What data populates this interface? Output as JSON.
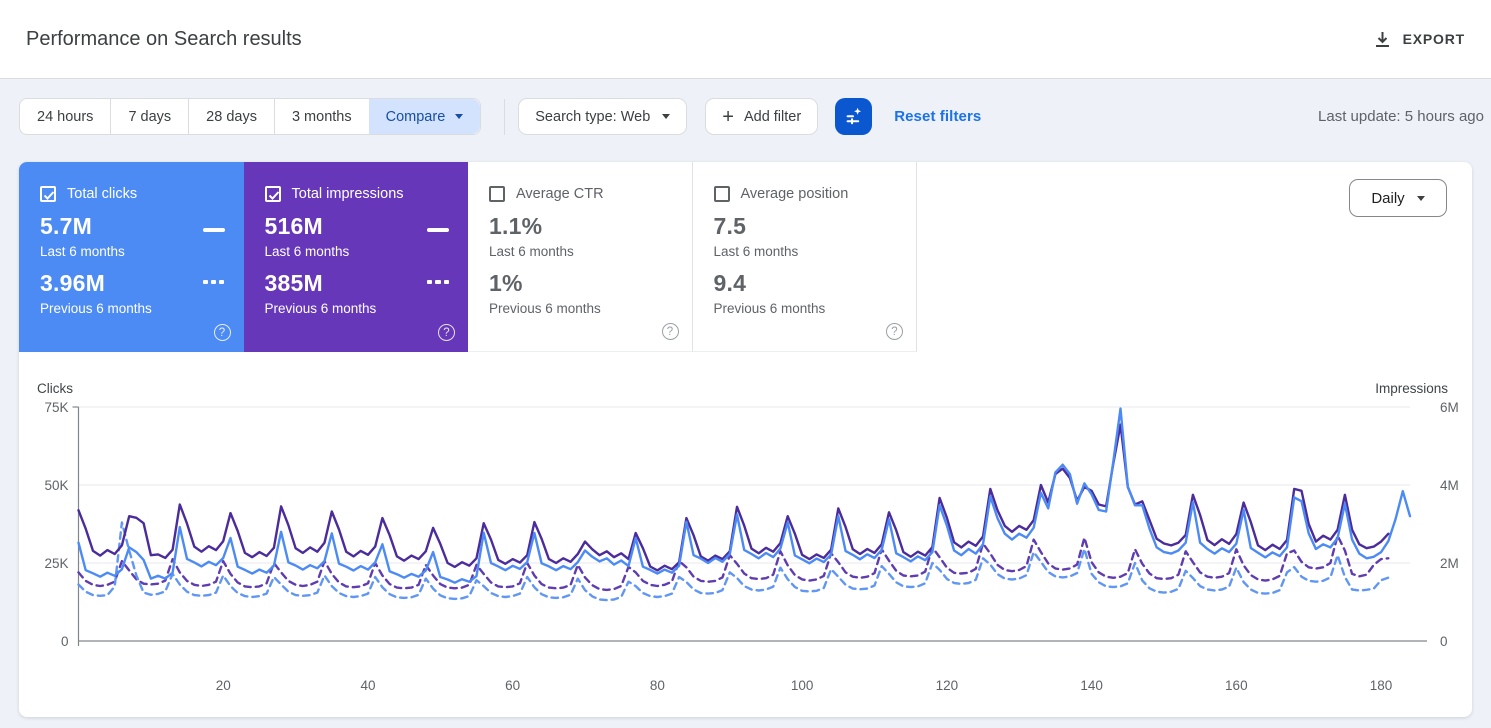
{
  "header": {
    "title": "Performance on Search results",
    "export_label": "EXPORT"
  },
  "filters": {
    "tabs": [
      "24 hours",
      "7 days",
      "28 days",
      "3 months"
    ],
    "compare_label": "Compare",
    "search_type_label": "Search type: Web",
    "add_filter_label": "Add filter",
    "reset_label": "Reset filters",
    "last_update": "Last update: 5 hours ago"
  },
  "granularity": "Daily",
  "cards": [
    {
      "label": "Total clicks",
      "checked": true,
      "color": "#4c8bf4",
      "value_current": "5.7M",
      "period_current": "Last 6 months",
      "value_previous": "3.96M",
      "period_previous": "Previous 6 months"
    },
    {
      "label": "Total impressions",
      "checked": true,
      "color": "#6637b8",
      "value_current": "516M",
      "period_current": "Last 6 months",
      "value_previous": "385M",
      "period_previous": "Previous 6 months"
    },
    {
      "label": "Average CTR",
      "checked": false,
      "value_current": "1.1%",
      "period_current": "Last 6 months",
      "value_previous": "1%",
      "period_previous": "Previous 6 months"
    },
    {
      "label": "Average position",
      "checked": false,
      "value_current": "7.5",
      "period_current": "Last 6 months",
      "value_previous": "9.4",
      "period_previous": "Previous 6 months"
    }
  ],
  "chart_data": {
    "type": "line",
    "x_ticks": [
      20,
      40,
      60,
      80,
      100,
      120,
      140,
      160,
      180
    ],
    "axes": {
      "left": {
        "title": "Clicks",
        "max": 75,
        "tick_labels": [
          "75K",
          "50K",
          "25K",
          "0"
        ]
      },
      "right": {
        "title": "Impressions",
        "max": 6,
        "tick_labels": [
          "6M",
          "4M",
          "2M",
          "0"
        ]
      }
    },
    "series": [
      {
        "name": "Impressions - Previous 6 months",
        "axis": "right",
        "style": "dashed",
        "color": "#5f3cb0",
        "values": [
          1.76,
          1.54,
          1.44,
          1.41,
          1.44,
          1.52,
          2.05,
          1.81,
          1.58,
          1.47,
          1.45,
          1.47,
          1.55,
          2.1,
          1.76,
          1.54,
          1.44,
          1.41,
          1.44,
          1.52,
          2.05,
          1.72,
          1.5,
          1.4,
          1.38,
          1.4,
          1.48,
          2.0,
          1.76,
          1.54,
          1.44,
          1.41,
          1.44,
          1.52,
          2.05,
          1.72,
          1.5,
          1.4,
          1.38,
          1.4,
          1.48,
          2.0,
          1.68,
          1.46,
          1.37,
          1.35,
          1.37,
          1.44,
          1.95,
          1.68,
          1.46,
          1.37,
          1.35,
          1.37,
          1.44,
          1.95,
          1.72,
          1.5,
          1.4,
          1.38,
          1.4,
          1.48,
          2.0,
          1.68,
          1.46,
          1.37,
          1.35,
          1.37,
          1.44,
          1.95,
          1.63,
          1.43,
          1.33,
          1.31,
          1.33,
          1.41,
          1.9,
          1.76,
          1.54,
          1.44,
          1.41,
          1.44,
          1.52,
          2.05,
          1.89,
          1.65,
          1.54,
          1.52,
          1.54,
          1.63,
          2.2,
          1.98,
          1.73,
          1.61,
          1.59,
          1.61,
          1.7,
          2.3,
          1.94,
          1.69,
          1.58,
          1.55,
          1.58,
          1.67,
          2.25,
          2.02,
          1.76,
          1.65,
          1.62,
          1.65,
          1.74,
          2.35,
          2.06,
          1.8,
          1.68,
          1.66,
          1.68,
          1.78,
          2.4,
          2.15,
          1.88,
          1.75,
          1.73,
          1.75,
          1.85,
          2.5,
          2.24,
          1.95,
          1.82,
          1.79,
          1.82,
          1.92,
          2.6,
          2.28,
          1.99,
          1.86,
          1.83,
          1.86,
          1.96,
          2.65,
          2.02,
          1.76,
          1.65,
          1.62,
          1.65,
          1.74,
          2.35,
          1.98,
          1.73,
          1.61,
          1.59,
          1.61,
          1.7,
          2.3,
          2.02,
          1.76,
          1.65,
          1.62,
          1.65,
          1.74,
          2.35,
          1.94,
          1.69,
          1.58,
          1.55,
          1.58,
          1.67,
          2.25,
          2.32,
          2.03,
          1.89,
          1.86,
          1.89,
          2.0,
          2.7,
          2.32,
          1.72,
          1.66,
          1.7,
          1.95,
          2.1,
          2.12
        ]
      },
      {
        "name": "Clicks - Previous 6 months",
        "axis": "left",
        "style": "dashed",
        "color": "#6197f2",
        "values": [
          18.1,
          15.8,
          14.7,
          14.5,
          14.7,
          17.5,
          38.0,
          29.0,
          21.0,
          15.5,
          14.8,
          15.1,
          15.9,
          21.5,
          18.1,
          15.8,
          14.7,
          14.5,
          14.7,
          15.5,
          21.0,
          17.6,
          15.4,
          14.4,
          14.1,
          14.4,
          15.2,
          20.5,
          18.1,
          15.8,
          14.7,
          14.5,
          14.7,
          15.5,
          21.0,
          17.6,
          15.4,
          14.4,
          14.1,
          14.4,
          15.2,
          20.5,
          17.2,
          15.0,
          14.0,
          13.8,
          14.0,
          14.8,
          20.0,
          16.8,
          14.6,
          13.7,
          13.5,
          13.7,
          14.4,
          19.5,
          17.6,
          15.4,
          14.4,
          14.1,
          14.4,
          15.2,
          20.5,
          17.2,
          15.0,
          14.0,
          13.8,
          14.0,
          14.8,
          20.0,
          16.3,
          14.3,
          13.3,
          13.1,
          13.3,
          14.1,
          19.0,
          17.6,
          15.4,
          14.4,
          14.1,
          14.4,
          15.2,
          20.5,
          18.9,
          16.5,
          15.4,
          15.2,
          15.4,
          16.3,
          22.0,
          20.2,
          17.6,
          16.5,
          16.2,
          16.5,
          17.4,
          23.5,
          19.8,
          17.3,
          16.1,
          15.9,
          16.1,
          17.0,
          23.0,
          20.6,
          18.0,
          16.8,
          16.6,
          16.8,
          17.8,
          24.0,
          21.5,
          18.8,
          17.5,
          17.3,
          17.5,
          18.5,
          25.0,
          22.8,
          19.9,
          18.6,
          18.3,
          18.6,
          19.6,
          26.5,
          24.5,
          21.4,
          20.0,
          19.7,
          20.0,
          21.1,
          28.5,
          25.4,
          22.1,
          20.7,
          20.4,
          20.7,
          21.8,
          29.5,
          21.5,
          18.8,
          17.5,
          17.3,
          17.5,
          18.5,
          25.0,
          19.4,
          16.9,
          15.8,
          15.5,
          15.8,
          16.7,
          22.5,
          20.2,
          17.6,
          16.5,
          16.2,
          16.5,
          17.4,
          23.5,
          18.9,
          16.5,
          15.4,
          15.2,
          15.4,
          16.3,
          22.0,
          23.7,
          20.6,
          19.3,
          19.0,
          19.3,
          20.4,
          27.5,
          20.5,
          16.5,
          16.2,
          16.4,
          16.8,
          19.5,
          20.3
        ]
      },
      {
        "name": "Impressions - Last 6 months",
        "axis": "right",
        "style": "solid",
        "color": "#4b2c9c",
        "values": [
          3.35,
          2.88,
          2.31,
          2.19,
          2.33,
          2.23,
          2.45,
          3.2,
          3.16,
          3.02,
          2.2,
          2.22,
          2.13,
          2.34,
          3.5,
          3.01,
          2.42,
          2.29,
          2.43,
          2.33,
          2.56,
          3.28,
          2.82,
          2.26,
          2.15,
          2.28,
          2.18,
          2.39,
          3.45,
          2.97,
          2.38,
          2.26,
          2.4,
          2.29,
          2.52,
          3.32,
          2.86,
          2.29,
          2.17,
          2.31,
          2.21,
          2.42,
          3.15,
          2.71,
          2.17,
          2.06,
          2.19,
          2.1,
          2.3,
          2.9,
          2.49,
          2.0,
          1.9,
          2.02,
          1.93,
          2.12,
          3.02,
          2.6,
          2.08,
          1.98,
          2.1,
          2.01,
          2.2,
          3.05,
          2.62,
          2.1,
          2.0,
          2.12,
          2.03,
          2.23,
          2.55,
          2.35,
          2.2,
          2.3,
          2.15,
          2.25,
          2.1,
          2.77,
          2.38,
          1.91,
          1.81,
          1.93,
          1.84,
          2.02,
          3.15,
          2.71,
          2.17,
          2.06,
          2.19,
          2.1,
          2.3,
          3.44,
          2.96,
          2.37,
          2.25,
          2.39,
          2.29,
          2.51,
          3.2,
          2.75,
          2.21,
          2.1,
          2.22,
          2.13,
          2.34,
          3.4,
          2.92,
          2.35,
          2.23,
          2.36,
          2.26,
          2.48,
          3.3,
          2.84,
          2.28,
          2.16,
          2.29,
          2.19,
          2.41,
          3.67,
          3.16,
          2.53,
          2.4,
          2.55,
          2.44,
          2.68,
          3.9,
          3.35,
          2.95,
          2.8,
          2.95,
          2.85,
          3.1,
          4.0,
          3.55,
          4.28,
          4.42,
          4.18,
          3.6,
          3.95,
          3.85,
          3.5,
          3.45,
          4.55,
          5.55,
          3.95,
          3.5,
          3.58,
          3.1,
          2.62,
          2.5,
          2.45,
          2.52,
          2.72,
          3.75,
          3.23,
          2.59,
          2.46,
          2.61,
          2.49,
          2.74,
          3.55,
          3.05,
          2.45,
          2.33,
          2.47,
          2.36,
          2.59,
          3.9,
          3.85,
          3.0,
          2.55,
          2.7,
          2.6,
          2.85,
          3.75,
          2.85,
          2.48,
          2.38,
          2.42,
          2.55,
          2.75
        ]
      },
      {
        "name": "Clicks - Last 6 months",
        "axis": "left",
        "style": "solid",
        "color": "#4c8bf5",
        "values": [
          31.5,
          22.7,
          21.7,
          20.6,
          21.9,
          20.9,
          23.0,
          30.0,
          28.5,
          26.0,
          20.0,
          20.9,
          20.0,
          21.9,
          36.5,
          26.3,
          25.2,
          23.9,
          25.4,
          24.3,
          26.6,
          33.0,
          23.8,
          22.8,
          21.6,
          22.9,
          21.9,
          24.1,
          35.0,
          25.2,
          24.2,
          22.9,
          24.3,
          23.3,
          25.6,
          34.5,
          24.8,
          23.8,
          22.6,
          24.0,
          22.9,
          25.2,
          31.0,
          22.3,
          21.4,
          20.3,
          21.5,
          20.6,
          22.6,
          28.5,
          20.5,
          19.7,
          18.7,
          19.8,
          19.0,
          20.8,
          34.7,
          25.0,
          23.9,
          22.7,
          24.1,
          23.1,
          25.3,
          34.6,
          24.9,
          23.9,
          22.7,
          24.0,
          23.0,
          25.3,
          29.0,
          27.0,
          25.5,
          26.5,
          24.5,
          25.8,
          24.0,
          33.0,
          23.8,
          22.8,
          21.6,
          22.9,
          21.9,
          24.1,
          38.2,
          27.5,
          26.4,
          25.0,
          26.6,
          25.4,
          27.9,
          40.5,
          29.2,
          27.9,
          26.5,
          28.2,
          26.9,
          29.6,
          38.0,
          27.4,
          26.2,
          24.9,
          26.4,
          25.3,
          27.7,
          40.0,
          28.8,
          27.6,
          26.2,
          27.8,
          26.6,
          29.2,
          39.0,
          28.1,
          26.9,
          25.5,
          27.1,
          25.9,
          28.5,
          43.5,
          37.0,
          29.0,
          27.5,
          29.5,
          28.0,
          31.0,
          46.3,
          39.4,
          34.4,
          32.5,
          34.4,
          33.1,
          36.3,
          47.5,
          42.5,
          54.0,
          56.5,
          53.5,
          44.0,
          50.5,
          47.0,
          42.0,
          41.5,
          57.5,
          74.5,
          49.5,
          43.5,
          43.5,
          36.0,
          30.0,
          28.5,
          28.0,
          29.0,
          31.5,
          44.5,
          31.5,
          29.5,
          28.0,
          29.7,
          28.5,
          31.2,
          42.0,
          29.8,
          28.3,
          26.8,
          28.4,
          27.2,
          30.0,
          46.0,
          44.8,
          34.5,
          29.5,
          31.0,
          30.0,
          33.0,
          44.0,
          32.5,
          28.0,
          26.5,
          27.0,
          28.5,
          32.0,
          39.0,
          48.0,
          40.0
        ]
      }
    ]
  }
}
